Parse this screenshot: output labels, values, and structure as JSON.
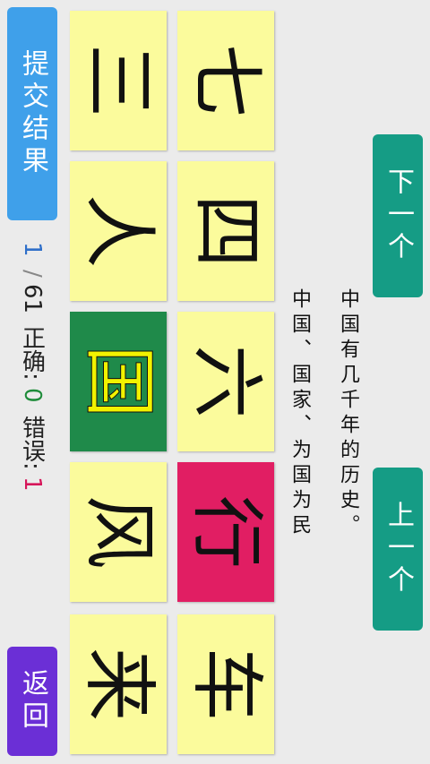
{
  "buttons": {
    "back": "返回",
    "submit": "提交结果",
    "prev": "上一个",
    "next": "下一个"
  },
  "status": {
    "current": "1",
    "separator": "/",
    "total": "61",
    "correct_label": "正确:",
    "correct_value": "0",
    "wrong_label": "错误:",
    "wrong_value": "1"
  },
  "tiles": [
    {
      "char": "来",
      "state": "normal"
    },
    {
      "char": "风",
      "state": "normal"
    },
    {
      "char": "国",
      "state": "correct"
    },
    {
      "char": "人",
      "state": "normal"
    },
    {
      "char": "三",
      "state": "normal"
    },
    {
      "char": "车",
      "state": "normal"
    },
    {
      "char": "行",
      "state": "wrong"
    },
    {
      "char": "六",
      "state": "normal"
    },
    {
      "char": "四",
      "state": "normal"
    },
    {
      "char": "七",
      "state": "normal"
    }
  ],
  "hint_lines": [
    "中国、国家、为国为民",
    "中国有几千年的历史。"
  ],
  "colors": {
    "back_button": "#6b2fd6",
    "submit_button": "#3fa0ea",
    "nav_button": "#159c85",
    "current_index": "#2f6fc9",
    "correct": "#1e8c3a",
    "wrong": "#d6165a",
    "tile_correct": "#1f8a4a",
    "tile_wrong": "#e11e63",
    "tile_default": "#fbfb9c"
  }
}
